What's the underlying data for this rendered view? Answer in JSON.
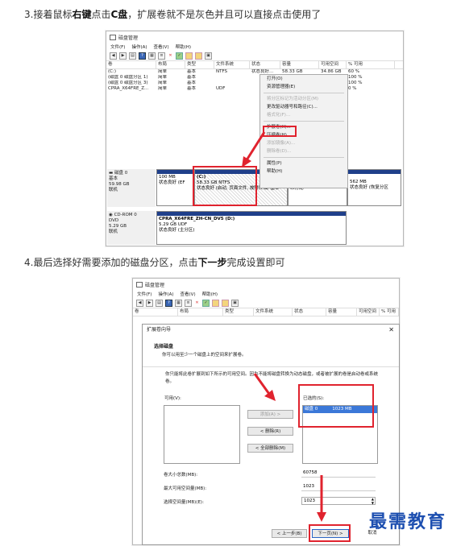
{
  "steps": {
    "step3": {
      "prefix": "3.接着鼠标",
      "bold1": "右键",
      "mid": "点击",
      "bold2": "C盘",
      "suffix": "，扩展卷就不是灰色并且可以直接点击使用了"
    },
    "step4": {
      "prefix": "4.最后选择好需要添加的磁盘分区，点击",
      "bold1": "下一步",
      "suffix": "完成设置即可"
    }
  },
  "window1": {
    "title": "磁盘管理",
    "menu": [
      "文件(F)",
      "操作(A)",
      "查看(V)",
      "帮助(H)"
    ],
    "columns": [
      "卷",
      "布局",
      "类型",
      "文件系统",
      "状态",
      "容量",
      "可用空间",
      "% 可用"
    ],
    "rows": [
      [
        "(C:)",
        "简单",
        "基本",
        "NTFS",
        "状态良好...",
        "58.33 GB",
        "34.86 GB",
        "60 %"
      ],
      [
        "(磁盘 0 磁盘分区 1)",
        "简单",
        "基本",
        "",
        "",
        "",
        "",
        "100 %"
      ],
      [
        "(磁盘 0 磁盘分区 3)",
        "简单",
        "基本",
        "",
        "",
        "",
        "",
        "100 %"
      ],
      [
        "CPRA_X64FRE_Z...",
        "简单",
        "基本",
        "UDF",
        "",
        "",
        "",
        "0 %"
      ]
    ],
    "context_menu": [
      {
        "label": "打开(O)",
        "disabled": false
      },
      {
        "label": "资源管理器(E)",
        "disabled": false
      },
      {
        "label": "将分区标记为活动分区(M)",
        "disabled": true
      },
      {
        "label": "更改驱动器号和路径(C)...",
        "disabled": false
      },
      {
        "label": "格式化(F)...",
        "disabled": true
      },
      {
        "label": "扩展卷(X)...",
        "disabled": false
      },
      {
        "label": "压缩卷(H)...",
        "disabled": false
      },
      {
        "label": "添加镜像(A)...",
        "disabled": true
      },
      {
        "label": "删除卷(D)...",
        "disabled": true
      },
      {
        "label": "属性(P)",
        "disabled": false
      },
      {
        "label": "帮助(H)",
        "disabled": false
      }
    ],
    "disk0": {
      "name": "磁盘 0",
      "type": "基本",
      "size": "59.98 GB",
      "status": "联机",
      "partitions": [
        {
          "line1": "",
          "line2": "100 MB",
          "line3": "状态良好 (EF"
        },
        {
          "line1": "(C:)",
          "line2": "58.33 GB NTFS",
          "line3": "状态良好 (启动, 页面文件, 故障转储, 基本"
        },
        {
          "line1": "",
          "line2": "",
          "line3": "未分配"
        },
        {
          "line1": "",
          "line2": "562 MB",
          "line3": "状态良好 (恢复分区"
        }
      ]
    },
    "cdrom": {
      "name": "CD-ROM 0",
      "type": "DVD",
      "size": "5.29 GB",
      "status": "联机",
      "volume": "CPRA_X64FRE_ZH-CN_DV5 (D:)",
      "vol_size": "5.29 GB UDF",
      "vol_status": "状态良好 (主分区)"
    }
  },
  "window2": {
    "title": "磁盘管理",
    "menu": [
      "文件(F)",
      "操作(A)",
      "查看(V)",
      "帮助(H)"
    ],
    "columns": [
      "卷",
      "布局",
      "类型",
      "文件系统",
      "状态",
      "容量",
      "可用空间",
      "% 可用"
    ],
    "wizard": {
      "title": "扩展卷向导",
      "heading": "选择磁盘",
      "subheading": "你可以用至少一个磁盘上的空间来扩展卷。",
      "description": "你只能将此卷扩展到如下所示的可用空间。因为不能将磁盘转换为动态磁盘，或者被扩展的卷是启动卷或系统卷。",
      "available_label": "可用(V):",
      "selected_label": "已选的(S):",
      "selected_items": [
        {
          "disk": "磁盘 0",
          "size": "1023 MB"
        }
      ],
      "add_button": "添加(A) >",
      "remove_button": "< 删除(R)",
      "remove_all_button": "< 全部删除(M)",
      "total_label": "卷大小总数(MB):",
      "total_value": "60758",
      "max_label": "最大可用空间量(MB):",
      "max_value": "1023",
      "select_label": "选择空间量(MB)(E):",
      "select_value": "1023",
      "back_button": "< 上一步(B)",
      "next_button": "下一页(N) >",
      "cancel_button": "取消"
    }
  },
  "watermark": "最需教育",
  "colors": {
    "highlight_red": "#e0232e",
    "partition_bar": "#1f3f8a",
    "selection_blue": "#3b78d8"
  }
}
